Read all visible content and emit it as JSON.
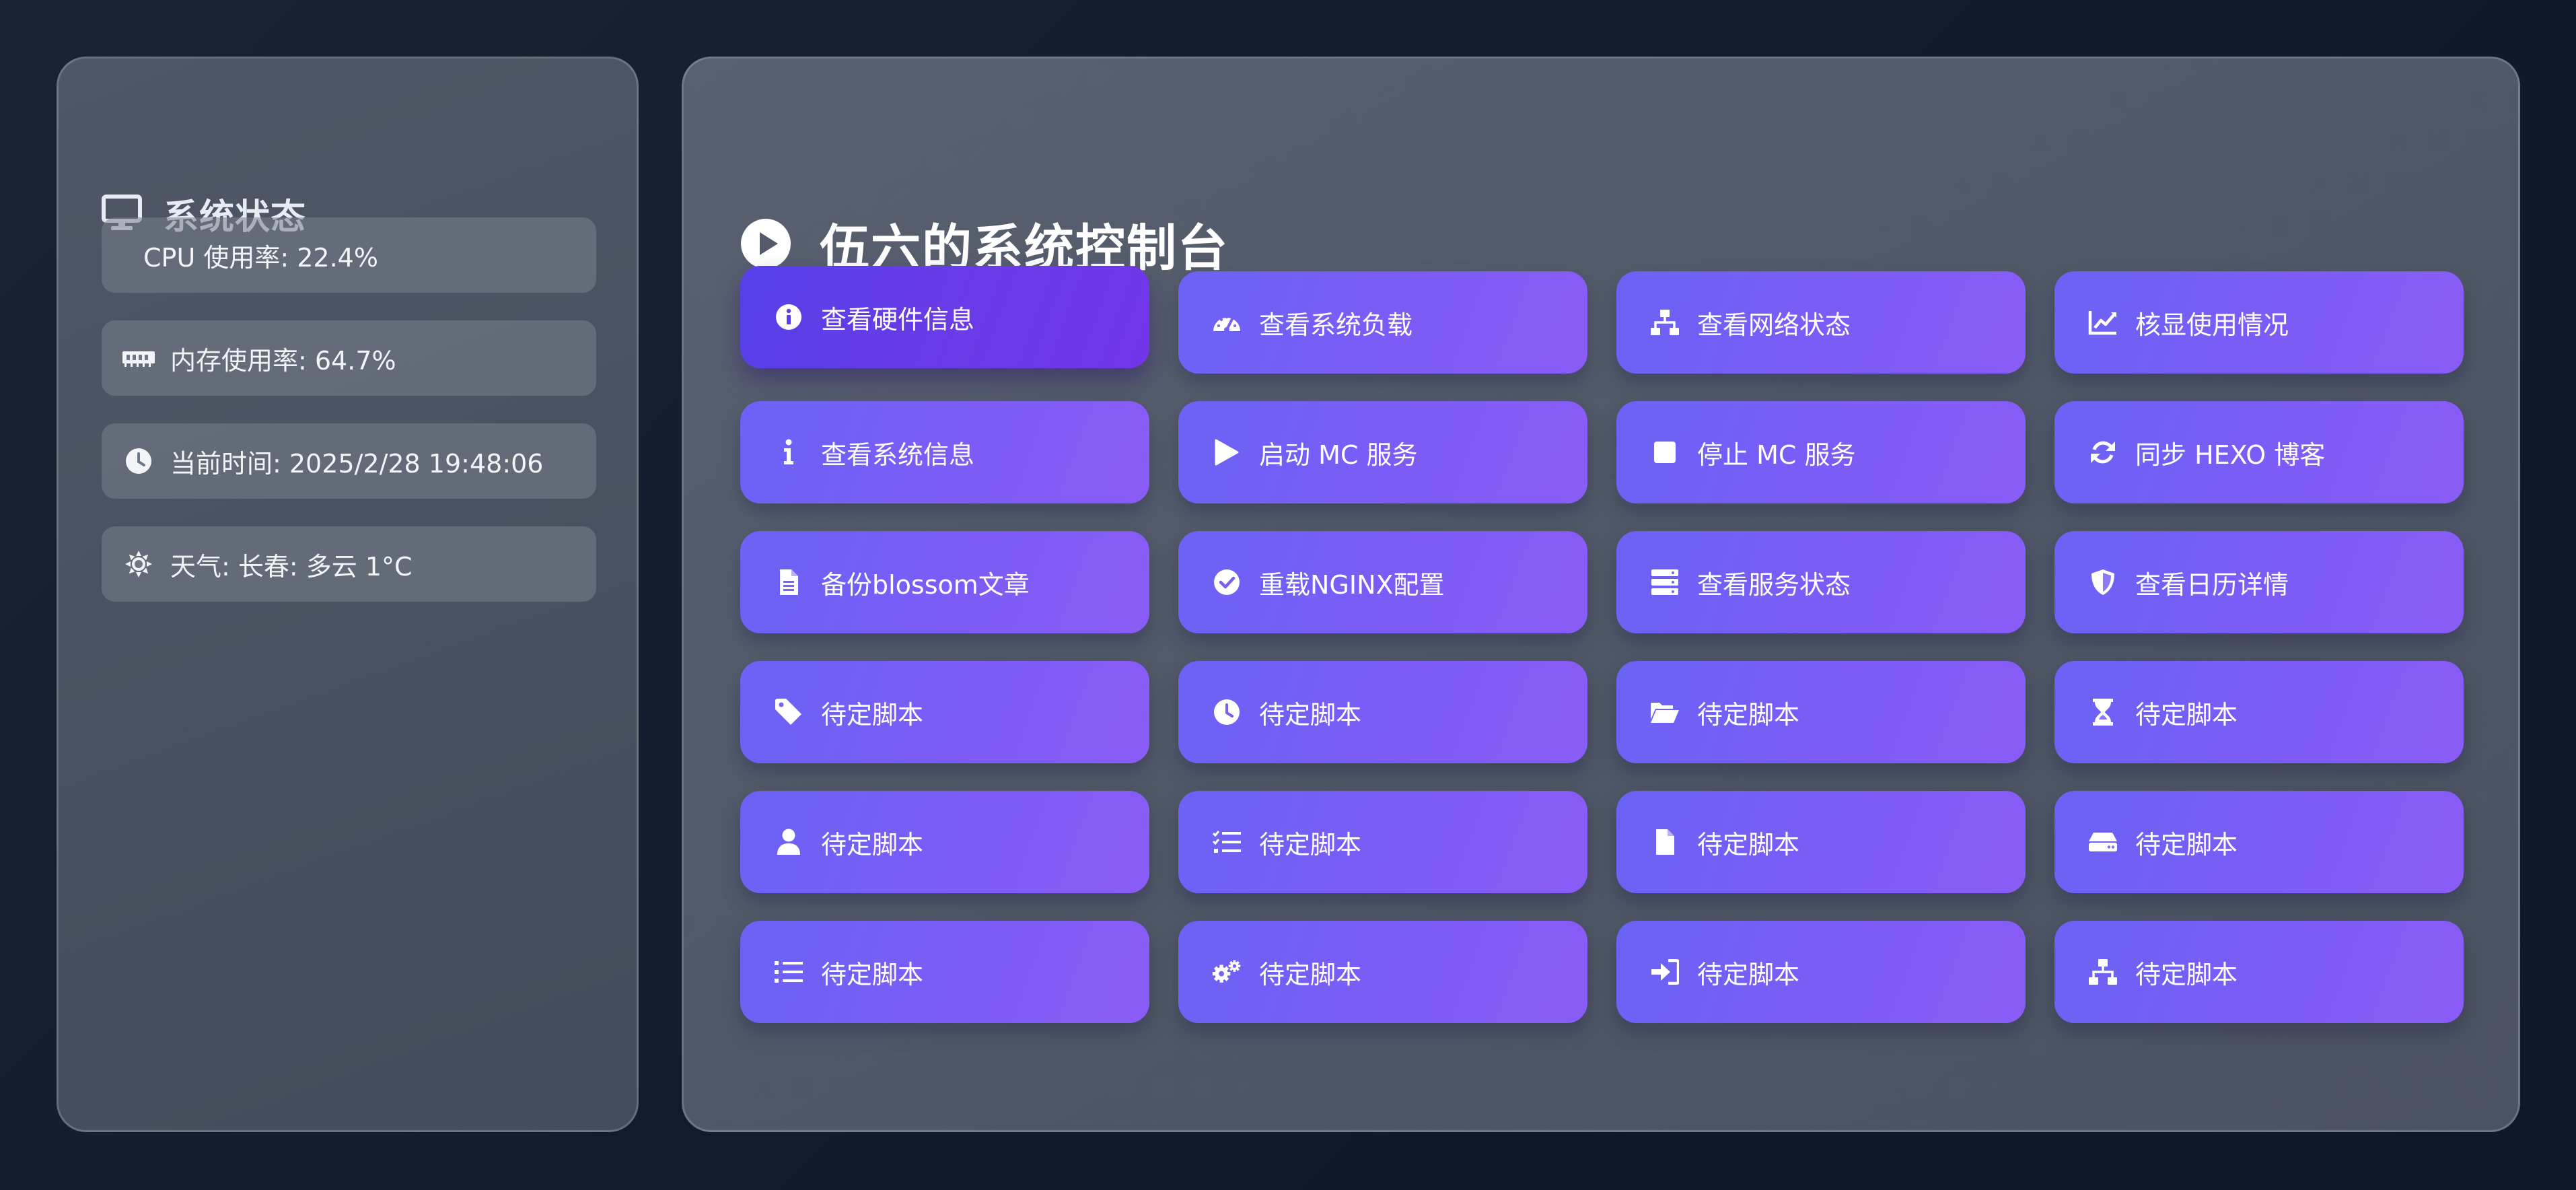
{
  "sidebar": {
    "title": "系统状态",
    "title_icon": "monitor-icon",
    "stats": [
      {
        "icon": "none",
        "text": "CPU 使用率: 22.4%"
      },
      {
        "icon": "memory-icon",
        "text": "内存使用率: 64.7%"
      },
      {
        "icon": "clock-icon",
        "text": "当前时间: 2025/2/28 19:48:06"
      },
      {
        "icon": "sun-icon",
        "text": "天气: 长春: 多云 1°C"
      }
    ]
  },
  "main": {
    "title": "伍六的系统控制台",
    "title_icon": "play-circle-icon",
    "buttons": [
      {
        "icon": "info-circle-icon",
        "label": "查看硬件信息",
        "active": true
      },
      {
        "icon": "gauge-icon",
        "label": "查看系统负载"
      },
      {
        "icon": "network-icon",
        "label": "查看网络状态"
      },
      {
        "icon": "chart-line-icon",
        "label": "核显使用情况"
      },
      {
        "icon": "info-icon",
        "label": "查看系统信息"
      },
      {
        "icon": "play-icon",
        "label": "启动 MC 服务"
      },
      {
        "icon": "stop-icon",
        "label": "停止 MC 服务"
      },
      {
        "icon": "sync-icon",
        "label": "同步 HEXO 博客"
      },
      {
        "icon": "file-icon",
        "label": "备份blossom文章"
      },
      {
        "icon": "check-circle-icon",
        "label": "重载NGINX配置"
      },
      {
        "icon": "server-icon",
        "label": "查看服务状态"
      },
      {
        "icon": "shield-icon",
        "label": "查看日历详情"
      },
      {
        "icon": "tag-icon",
        "label": "待定脚本"
      },
      {
        "icon": "clock-icon",
        "label": "待定脚本"
      },
      {
        "icon": "folder-open-icon",
        "label": "待定脚本"
      },
      {
        "icon": "hourglass-icon",
        "label": "待定脚本"
      },
      {
        "icon": "user-icon",
        "label": "待定脚本"
      },
      {
        "icon": "tasks-icon",
        "label": "待定脚本"
      },
      {
        "icon": "file-blank-icon",
        "label": "待定脚本"
      },
      {
        "icon": "hdd-icon",
        "label": "待定脚本"
      },
      {
        "icon": "list-icon",
        "label": "待定脚本"
      },
      {
        "icon": "cogs-icon",
        "label": "待定脚本"
      },
      {
        "icon": "sign-in-icon",
        "label": "待定脚本"
      },
      {
        "icon": "sitemap-icon",
        "label": "待定脚本"
      }
    ]
  },
  "colors": {
    "background": "#131b2c",
    "button_gradient_start": "#6a63f5",
    "button_gradient_end": "#8a5cf6",
    "button_active_start": "#5640e8",
    "button_active_end": "#7236e8"
  }
}
